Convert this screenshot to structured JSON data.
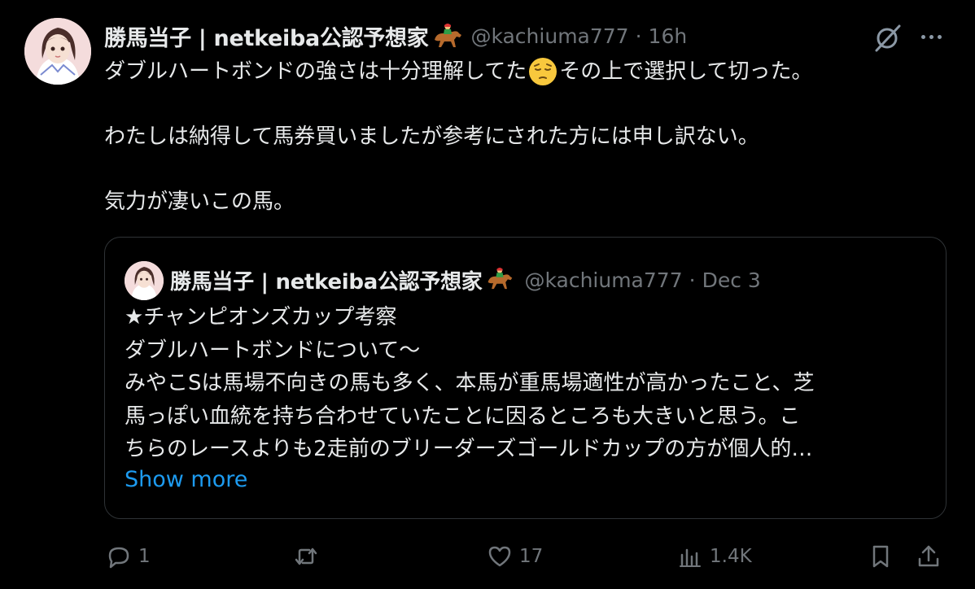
{
  "post": {
    "author_name": "勝馬当子 | netkeiba公認予想家",
    "handle": "@kachiuma777",
    "separator": "·",
    "time": "16h",
    "text": {
      "line1_before": "ダブルハートボンドの強さは十分理解してた",
      "line1_emoji": "pensive-face",
      "line1_after": "その上で選択して切った。",
      "line2": "わたしは納得して馬券買いましたが参考にされた方には申し訳ない。",
      "line3": "気力が凄いこの馬。"
    }
  },
  "quote": {
    "author_name": "勝馬当子 | netkeiba公認予想家",
    "handle": "@kachiuma777",
    "separator": "·",
    "date": "Dec 3",
    "lines": [
      "★チャンピオンズカップ考察",
      "ダブルハートボンドについて〜",
      "みやこSは馬場不向きの馬も多く、本馬が重馬場適性が高かったこと、芝",
      "馬っぽい血統を持ち合わせていたことに因るところも大きいと思う。こ",
      "ちらのレースよりも2走前のブリーダーズゴールドカップの方が個人的…"
    ],
    "show_more": "Show more"
  },
  "actions": {
    "reply_count": "1",
    "repost_count": "",
    "like_count": "17",
    "views_count": "1.4K"
  },
  "colors": {
    "background": "#000000",
    "text": "#e7e9ea",
    "muted": "#71767b",
    "link": "#1d9bf0",
    "border": "#2f3336"
  },
  "icons": [
    "grok-icon",
    "more-icon",
    "jockey-emoji-icon",
    "pensive-emoji-icon",
    "reply-icon",
    "repost-icon",
    "like-icon",
    "views-icon",
    "bookmark-icon",
    "share-icon"
  ]
}
